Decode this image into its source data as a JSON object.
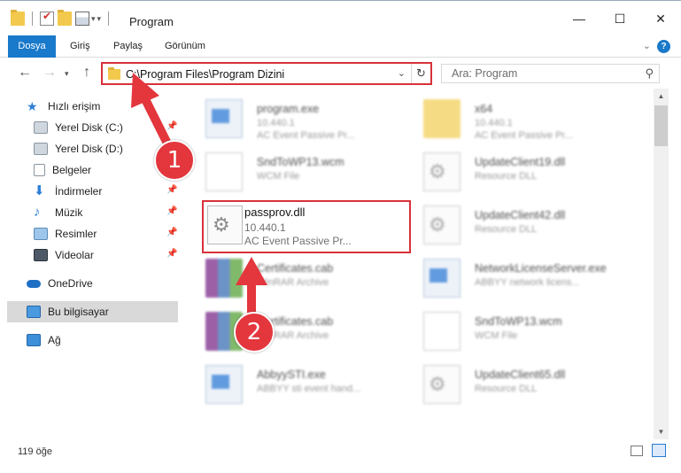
{
  "window": {
    "title": "Program",
    "controls": [
      "—",
      "☐",
      "✕"
    ]
  },
  "ribbon": {
    "tabs": [
      "Dosya",
      "Giriş",
      "Paylaş",
      "Görünüm"
    ],
    "active_tab": "Dosya",
    "help_label": "?"
  },
  "navbar": {
    "back": "←",
    "forward": "→",
    "up": "↑",
    "address": "C:\\Program Files\\Program Dizini",
    "search_placeholder": "Ara: Program"
  },
  "sidebar": {
    "items": [
      {
        "label": "Hızlı erişim",
        "icon": "star-icon",
        "pinned": false
      },
      {
        "label": "Yerel Disk (C:)",
        "icon": "drive-icon",
        "pinned": true
      },
      {
        "label": "Yerel Disk (D:)",
        "icon": "drive-icon",
        "pinned": true
      },
      {
        "label": "Belgeler",
        "icon": "documents-icon",
        "pinned": true
      },
      {
        "label": "İndirmeler",
        "icon": "download-icon",
        "pinned": true
      },
      {
        "label": "Müzik",
        "icon": "music-icon",
        "pinned": true
      },
      {
        "label": "Resimler",
        "icon": "pictures-icon",
        "pinned": true
      },
      {
        "label": "Videolar",
        "icon": "videos-icon",
        "pinned": true
      },
      {
        "label": "OneDrive",
        "icon": "cloud-icon",
        "pinned": false
      },
      {
        "label": "Bu bilgisayar",
        "icon": "computer-icon",
        "pinned": false
      },
      {
        "label": "Ağ",
        "icon": "network-icon",
        "pinned": false
      }
    ]
  },
  "files": [
    {
      "name": "program.exe",
      "line1": "10.440.1",
      "line2": "AC Event Passive Pr...",
      "icon": "exe-icon"
    },
    {
      "name": "x64",
      "line1": "10.440.1",
      "line2": "AC Event Passive Pr...",
      "icon": "folder-icon"
    },
    {
      "name": "SndToWP13.wcm",
      "line1": "WCM File",
      "line2": "",
      "icon": "document-icon"
    },
    {
      "name": "UpdateClient19.dll",
      "line1": "Resource DLL",
      "line2": "",
      "icon": "dll-icon"
    },
    {
      "name": "passprov.dll",
      "line1": "10.440.1",
      "line2": "AC Event Passive Pr...",
      "icon": "dll-icon"
    },
    {
      "name": "UpdateClient42.dll",
      "line1": "Resource DLL",
      "line2": "",
      "icon": "dll-icon"
    },
    {
      "name": "Certificates.cab",
      "line1": "WinRAR Archive",
      "line2": "",
      "icon": "archive-icon"
    },
    {
      "name": "NetworkLicenseServer.exe",
      "line1": "ABBYY network licens...",
      "line2": "",
      "icon": "exe-icon"
    },
    {
      "name": "Certificates.cab",
      "line1": "WinRAR Archive",
      "line2": "",
      "icon": "archive-icon"
    },
    {
      "name": "SndToWP13.wcm",
      "line1": "WCM File",
      "line2": "",
      "icon": "document-icon"
    },
    {
      "name": "AbbyySTI.exe",
      "line1": "ABBYY sti event hand...",
      "line2": "",
      "icon": "exe-icon"
    },
    {
      "name": "UpdateClient65.dll",
      "line1": "Resource DLL",
      "line2": "",
      "icon": "dll-icon"
    }
  ],
  "status": {
    "item_count": "119 öğe"
  },
  "annotations": {
    "step1": "1",
    "step2": "2",
    "color": "#e4363d"
  }
}
